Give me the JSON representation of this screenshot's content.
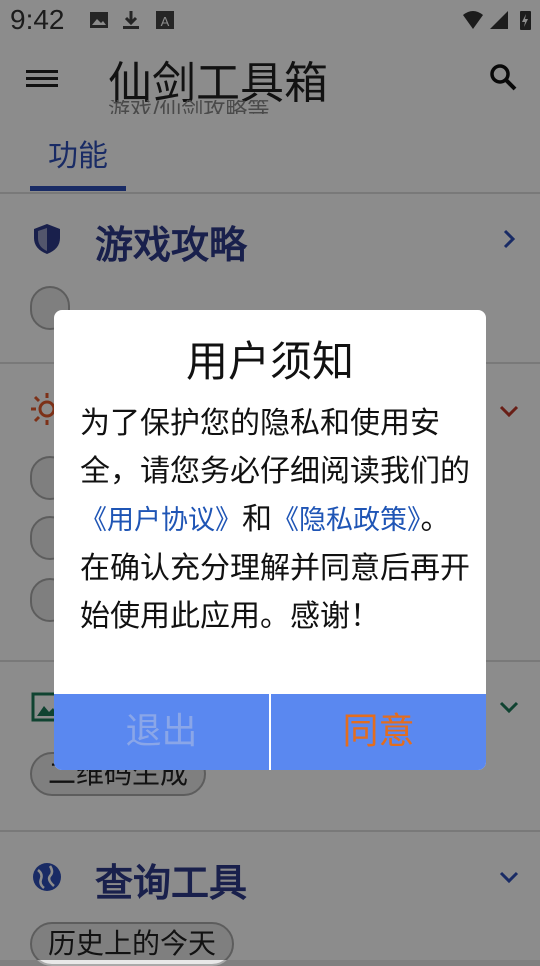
{
  "status_bar": {
    "time": "9:42"
  },
  "app_bar": {
    "title": "仙剑工具箱",
    "subtitle_fragment": "游戏/仙剑攻略等"
  },
  "tabs": [
    {
      "label": "功能"
    }
  ],
  "sections": [
    {
      "title": "游戏攻略"
    },
    {
      "title": ""
    },
    {
      "title": ""
    },
    {
      "title": "查询工具",
      "chips": [
        "历史上的今天"
      ]
    }
  ],
  "image_section_chip": "二维码生成",
  "dialog": {
    "title": "用户须知",
    "body_part1": "为了保护您的隐私和使用安全，请您务必仔细阅读我们的",
    "link_agreement": "《用户协议》",
    "body_and": "和",
    "link_privacy": "《隐私政策》",
    "body_part2": "。在确认充分理解并同意后再开始使用此应用。感谢！",
    "exit_label": "退出",
    "agree_label": "同意"
  },
  "colors": {
    "accent": "#2f4fb8",
    "dialog_button_bg": "#5a88f0",
    "agree_text": "#e36d1e",
    "exit_text": "#8aa6e8",
    "link": "#1f55b5"
  }
}
